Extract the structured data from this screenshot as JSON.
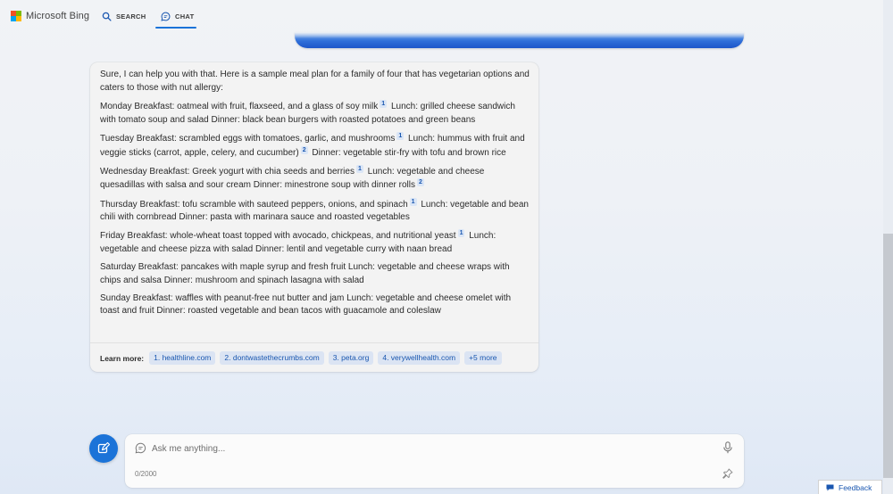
{
  "header": {
    "brand": "Microsoft Bing",
    "tabs": [
      {
        "label": "SEARCH",
        "icon": "search-icon",
        "active": false
      },
      {
        "label": "CHAT",
        "icon": "chat-icon",
        "active": true
      }
    ]
  },
  "response": {
    "paragraphs": [
      {
        "parts": [
          {
            "t": "Sure, I can help you with that. Here is a sample meal plan for a family of four that has vegetarian options and caters to those with nut allergy:"
          }
        ]
      },
      {
        "parts": [
          {
            "t": "Monday Breakfast: oatmeal with fruit, flaxseed, and a glass of soy milk"
          },
          {
            "c": "1"
          },
          {
            "t": " Lunch: grilled cheese sandwich with tomato soup and salad Dinner: black bean burgers with roasted potatoes and green beans"
          }
        ]
      },
      {
        "parts": [
          {
            "t": "Tuesday Breakfast: scrambled eggs with tomatoes, garlic, and mushrooms"
          },
          {
            "c": "1"
          },
          {
            "t": " Lunch: hummus with fruit and veggie sticks (carrot, apple, celery, and cucumber)"
          },
          {
            "c": "2"
          },
          {
            "t": " Dinner: vegetable stir-fry with tofu and brown rice"
          }
        ]
      },
      {
        "parts": [
          {
            "t": "Wednesday Breakfast: Greek yogurt with chia seeds and berries"
          },
          {
            "c": "1"
          },
          {
            "t": " Lunch: vegetable and cheese quesadillas with salsa and sour cream Dinner: minestrone soup with dinner rolls"
          },
          {
            "c": "2"
          }
        ]
      },
      {
        "parts": [
          {
            "t": "Thursday Breakfast: tofu scramble with sauteed peppers, onions, and spinach"
          },
          {
            "c": "1"
          },
          {
            "t": " Lunch: vegetable and bean chili with cornbread Dinner: pasta with marinara sauce and roasted vegetables"
          }
        ]
      },
      {
        "parts": [
          {
            "t": "Friday Breakfast: whole-wheat toast topped with avocado, chickpeas, and nutritional yeast"
          },
          {
            "c": "1"
          },
          {
            "t": " Lunch: vegetable and cheese pizza with salad Dinner: lentil and vegetable curry with naan bread"
          }
        ]
      },
      {
        "parts": [
          {
            "t": "Saturday Breakfast: pancakes with maple syrup and fresh fruit Lunch: vegetable and cheese wraps with chips and salsa Dinner: mushroom and spinach lasagna with salad"
          }
        ]
      },
      {
        "parts": [
          {
            "t": "Sunday Breakfast: waffles with peanut-free nut butter and jam Lunch: vegetable and cheese omelet with toast and fruit Dinner: roasted vegetable and bean tacos with guacamole and coleslaw"
          }
        ]
      }
    ],
    "learn_more_label": "Learn more:",
    "sources": [
      "1. healthline.com",
      "2. dontwastethecrumbs.com",
      "3. peta.org",
      "4. verywellhealth.com",
      "+5 more"
    ]
  },
  "composer": {
    "placeholder": "Ask me anything...",
    "value": "",
    "counter": "0/2000",
    "new_topic_icon": "new-topic-icon",
    "mic_icon": "mic-icon",
    "pin_icon": "pin-icon"
  },
  "feedback": {
    "label": "Feedback"
  },
  "colors": {
    "accent": "#1b73d8",
    "citation_bg": "#dbe6f6",
    "link": "#1a57b0",
    "card_bg": "#f3f3f3"
  }
}
